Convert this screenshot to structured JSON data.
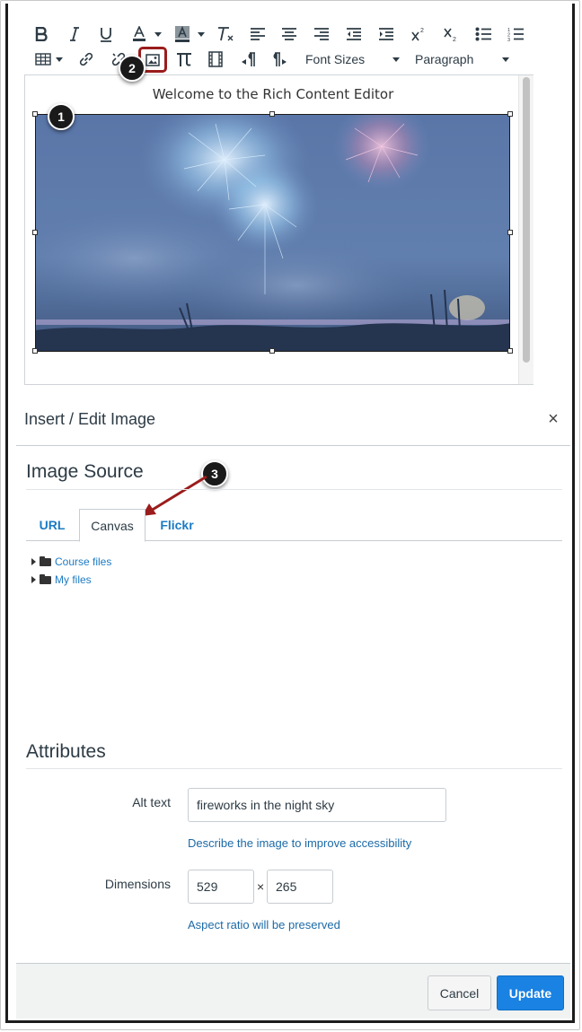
{
  "toolbar": {
    "row1": [
      "bold-icon",
      "italic-icon",
      "underline-icon",
      "text-color-icon",
      "background-color-icon",
      "clear-formatting-icon",
      "align-left-icon",
      "align-center-icon",
      "align-right-icon",
      "outdent-icon",
      "indent-icon",
      "superscript-icon",
      "subscript-icon",
      "bullet-list-icon",
      "numbered-list-icon"
    ],
    "row2": [
      "table-icon",
      "link-icon",
      "unlink-icon",
      "image-icon",
      "math-icon",
      "media-icon",
      "ltr-icon",
      "rtl-icon"
    ],
    "font_sizes_label": "Font Sizes",
    "paragraph_label": "Paragraph"
  },
  "editor": {
    "welcome_text": "Welcome to the Rich Content Editor",
    "image_alt": "fireworks in the night sky"
  },
  "callouts": [
    "1",
    "2",
    "3"
  ],
  "dialog": {
    "title": "Insert / Edit Image",
    "close_glyph": "×",
    "image_source_heading": "Image Source",
    "tabs": [
      {
        "label": "URL",
        "active": false
      },
      {
        "label": "Canvas",
        "active": true
      },
      {
        "label": "Flickr",
        "active": false
      }
    ],
    "tree": [
      {
        "label": "Course files"
      },
      {
        "label": "My files"
      }
    ],
    "attributes_heading": "Attributes",
    "alt_text_label": "Alt text",
    "alt_text_value": "fireworks in the night sky",
    "alt_text_hint": "Describe the image to improve accessibility",
    "dimensions_label": "Dimensions",
    "width_value": "529",
    "times_glyph": "×",
    "height_value": "265",
    "dimensions_hint": "Aspect ratio will be preserved",
    "cancel_label": "Cancel",
    "update_label": "Update"
  },
  "colors": {
    "accent": "#1a82e2",
    "link": "#1c7bc4",
    "callout_box": "#9b1c1c",
    "arrow": "#9b1c1c",
    "text": "#2d3b45"
  }
}
